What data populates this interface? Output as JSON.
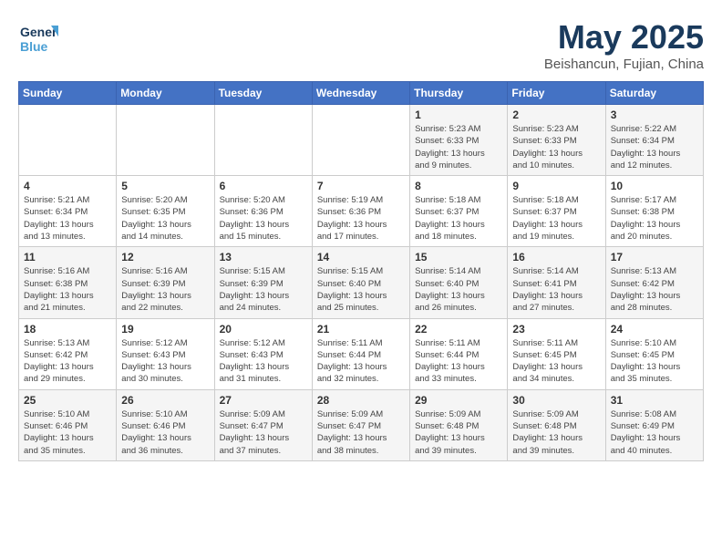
{
  "logo": {
    "line1": "General",
    "line2": "Blue"
  },
  "title": "May 2025",
  "subtitle": "Beishancun, Fujian, China",
  "headers": [
    "Sunday",
    "Monday",
    "Tuesday",
    "Wednesday",
    "Thursday",
    "Friday",
    "Saturday"
  ],
  "weeks": [
    [
      {
        "day": "",
        "info": ""
      },
      {
        "day": "",
        "info": ""
      },
      {
        "day": "",
        "info": ""
      },
      {
        "day": "",
        "info": ""
      },
      {
        "day": "1",
        "info": "Sunrise: 5:23 AM\nSunset: 6:33 PM\nDaylight: 13 hours\nand 9 minutes."
      },
      {
        "day": "2",
        "info": "Sunrise: 5:23 AM\nSunset: 6:33 PM\nDaylight: 13 hours\nand 10 minutes."
      },
      {
        "day": "3",
        "info": "Sunrise: 5:22 AM\nSunset: 6:34 PM\nDaylight: 13 hours\nand 12 minutes."
      }
    ],
    [
      {
        "day": "4",
        "info": "Sunrise: 5:21 AM\nSunset: 6:34 PM\nDaylight: 13 hours\nand 13 minutes."
      },
      {
        "day": "5",
        "info": "Sunrise: 5:20 AM\nSunset: 6:35 PM\nDaylight: 13 hours\nand 14 minutes."
      },
      {
        "day": "6",
        "info": "Sunrise: 5:20 AM\nSunset: 6:36 PM\nDaylight: 13 hours\nand 15 minutes."
      },
      {
        "day": "7",
        "info": "Sunrise: 5:19 AM\nSunset: 6:36 PM\nDaylight: 13 hours\nand 17 minutes."
      },
      {
        "day": "8",
        "info": "Sunrise: 5:18 AM\nSunset: 6:37 PM\nDaylight: 13 hours\nand 18 minutes."
      },
      {
        "day": "9",
        "info": "Sunrise: 5:18 AM\nSunset: 6:37 PM\nDaylight: 13 hours\nand 19 minutes."
      },
      {
        "day": "10",
        "info": "Sunrise: 5:17 AM\nSunset: 6:38 PM\nDaylight: 13 hours\nand 20 minutes."
      }
    ],
    [
      {
        "day": "11",
        "info": "Sunrise: 5:16 AM\nSunset: 6:38 PM\nDaylight: 13 hours\nand 21 minutes."
      },
      {
        "day": "12",
        "info": "Sunrise: 5:16 AM\nSunset: 6:39 PM\nDaylight: 13 hours\nand 22 minutes."
      },
      {
        "day": "13",
        "info": "Sunrise: 5:15 AM\nSunset: 6:39 PM\nDaylight: 13 hours\nand 24 minutes."
      },
      {
        "day": "14",
        "info": "Sunrise: 5:15 AM\nSunset: 6:40 PM\nDaylight: 13 hours\nand 25 minutes."
      },
      {
        "day": "15",
        "info": "Sunrise: 5:14 AM\nSunset: 6:40 PM\nDaylight: 13 hours\nand 26 minutes."
      },
      {
        "day": "16",
        "info": "Sunrise: 5:14 AM\nSunset: 6:41 PM\nDaylight: 13 hours\nand 27 minutes."
      },
      {
        "day": "17",
        "info": "Sunrise: 5:13 AM\nSunset: 6:42 PM\nDaylight: 13 hours\nand 28 minutes."
      }
    ],
    [
      {
        "day": "18",
        "info": "Sunrise: 5:13 AM\nSunset: 6:42 PM\nDaylight: 13 hours\nand 29 minutes."
      },
      {
        "day": "19",
        "info": "Sunrise: 5:12 AM\nSunset: 6:43 PM\nDaylight: 13 hours\nand 30 minutes."
      },
      {
        "day": "20",
        "info": "Sunrise: 5:12 AM\nSunset: 6:43 PM\nDaylight: 13 hours\nand 31 minutes."
      },
      {
        "day": "21",
        "info": "Sunrise: 5:11 AM\nSunset: 6:44 PM\nDaylight: 13 hours\nand 32 minutes."
      },
      {
        "day": "22",
        "info": "Sunrise: 5:11 AM\nSunset: 6:44 PM\nDaylight: 13 hours\nand 33 minutes."
      },
      {
        "day": "23",
        "info": "Sunrise: 5:11 AM\nSunset: 6:45 PM\nDaylight: 13 hours\nand 34 minutes."
      },
      {
        "day": "24",
        "info": "Sunrise: 5:10 AM\nSunset: 6:45 PM\nDaylight: 13 hours\nand 35 minutes."
      }
    ],
    [
      {
        "day": "25",
        "info": "Sunrise: 5:10 AM\nSunset: 6:46 PM\nDaylight: 13 hours\nand 35 minutes."
      },
      {
        "day": "26",
        "info": "Sunrise: 5:10 AM\nSunset: 6:46 PM\nDaylight: 13 hours\nand 36 minutes."
      },
      {
        "day": "27",
        "info": "Sunrise: 5:09 AM\nSunset: 6:47 PM\nDaylight: 13 hours\nand 37 minutes."
      },
      {
        "day": "28",
        "info": "Sunrise: 5:09 AM\nSunset: 6:47 PM\nDaylight: 13 hours\nand 38 minutes."
      },
      {
        "day": "29",
        "info": "Sunrise: 5:09 AM\nSunset: 6:48 PM\nDaylight: 13 hours\nand 39 minutes."
      },
      {
        "day": "30",
        "info": "Sunrise: 5:09 AM\nSunset: 6:48 PM\nDaylight: 13 hours\nand 39 minutes."
      },
      {
        "day": "31",
        "info": "Sunrise: 5:08 AM\nSunset: 6:49 PM\nDaylight: 13 hours\nand 40 minutes."
      }
    ]
  ]
}
